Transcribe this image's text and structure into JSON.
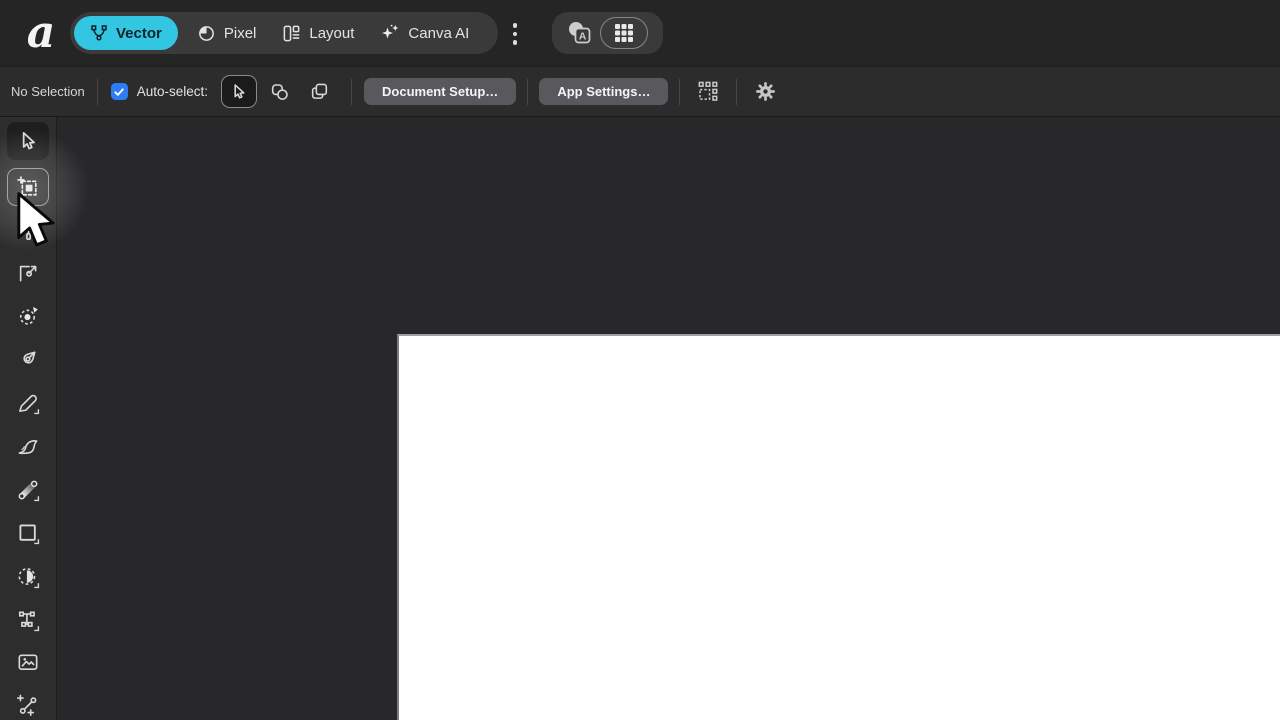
{
  "app": {
    "logo_letter": "a"
  },
  "colors": {
    "accent_cyan": "#32c6e2",
    "checkbox_blue": "#2e7cf6",
    "topbar_bg": "#252526",
    "context_toolbar_bg": "#2c2c2d",
    "sidebar_bg": "#2d2d2e",
    "canvas_bg": "#28282a",
    "page_bg": "#ffffff",
    "button_gray": "#59595d"
  },
  "topbar": {
    "personas": [
      {
        "label": "Vector",
        "selected": true,
        "icon": "vector-nodes-icon"
      },
      {
        "label": "Pixel",
        "selected": false,
        "icon": "pixel-circle-icon"
      },
      {
        "label": "Layout",
        "selected": false,
        "icon": "layout-pages-icon"
      },
      {
        "label": "Canva AI",
        "selected": false,
        "icon": "sparkles-icon"
      }
    ],
    "overflow_menu_icon": "kebab-vertical-icon",
    "right_group": {
      "character_button_letter": "A",
      "buttons": [
        {
          "icon": "character-translate-icon",
          "selected": false
        },
        {
          "icon": "app-grid-icon",
          "selected": true
        }
      ]
    }
  },
  "context_toolbar": {
    "status_label": "No Selection",
    "auto_select": {
      "label": "Auto-select:",
      "checked": true
    },
    "select_modes": [
      {
        "icon": "cursor-arrow-icon",
        "selected": true
      },
      {
        "icon": "shapes-overlap-icon",
        "selected": false
      },
      {
        "icon": "duplicate-squares-icon",
        "selected": false
      }
    ],
    "document_setup_label": "Document Setup…",
    "app_settings_label": "App Settings…",
    "snapping_icon": "snapping-grid-icon",
    "settings_icon": "gear-icon"
  },
  "tools_panel": {
    "tools": [
      {
        "name": "move-tool",
        "selected": true
      },
      {
        "name": "artboard-tool",
        "highlighted": true
      },
      {
        "name": "style-picker-tool"
      },
      {
        "name": "node-tool"
      },
      {
        "name": "point-transform-tool"
      },
      {
        "name": "pen-tool"
      },
      {
        "name": "pencil-tool"
      },
      {
        "name": "vector-brush-tool"
      },
      {
        "name": "fill-gradient-tool"
      },
      {
        "name": "rectangle-tool"
      },
      {
        "name": "vector-crop-tool"
      },
      {
        "name": "text-tool"
      },
      {
        "name": "place-image-tool"
      },
      {
        "name": "node-add-tool"
      }
    ]
  },
  "canvas": {
    "page": "blank-white-page"
  },
  "cursor": {
    "type": "pointer-arrow",
    "position": "over-artboard-tool"
  }
}
